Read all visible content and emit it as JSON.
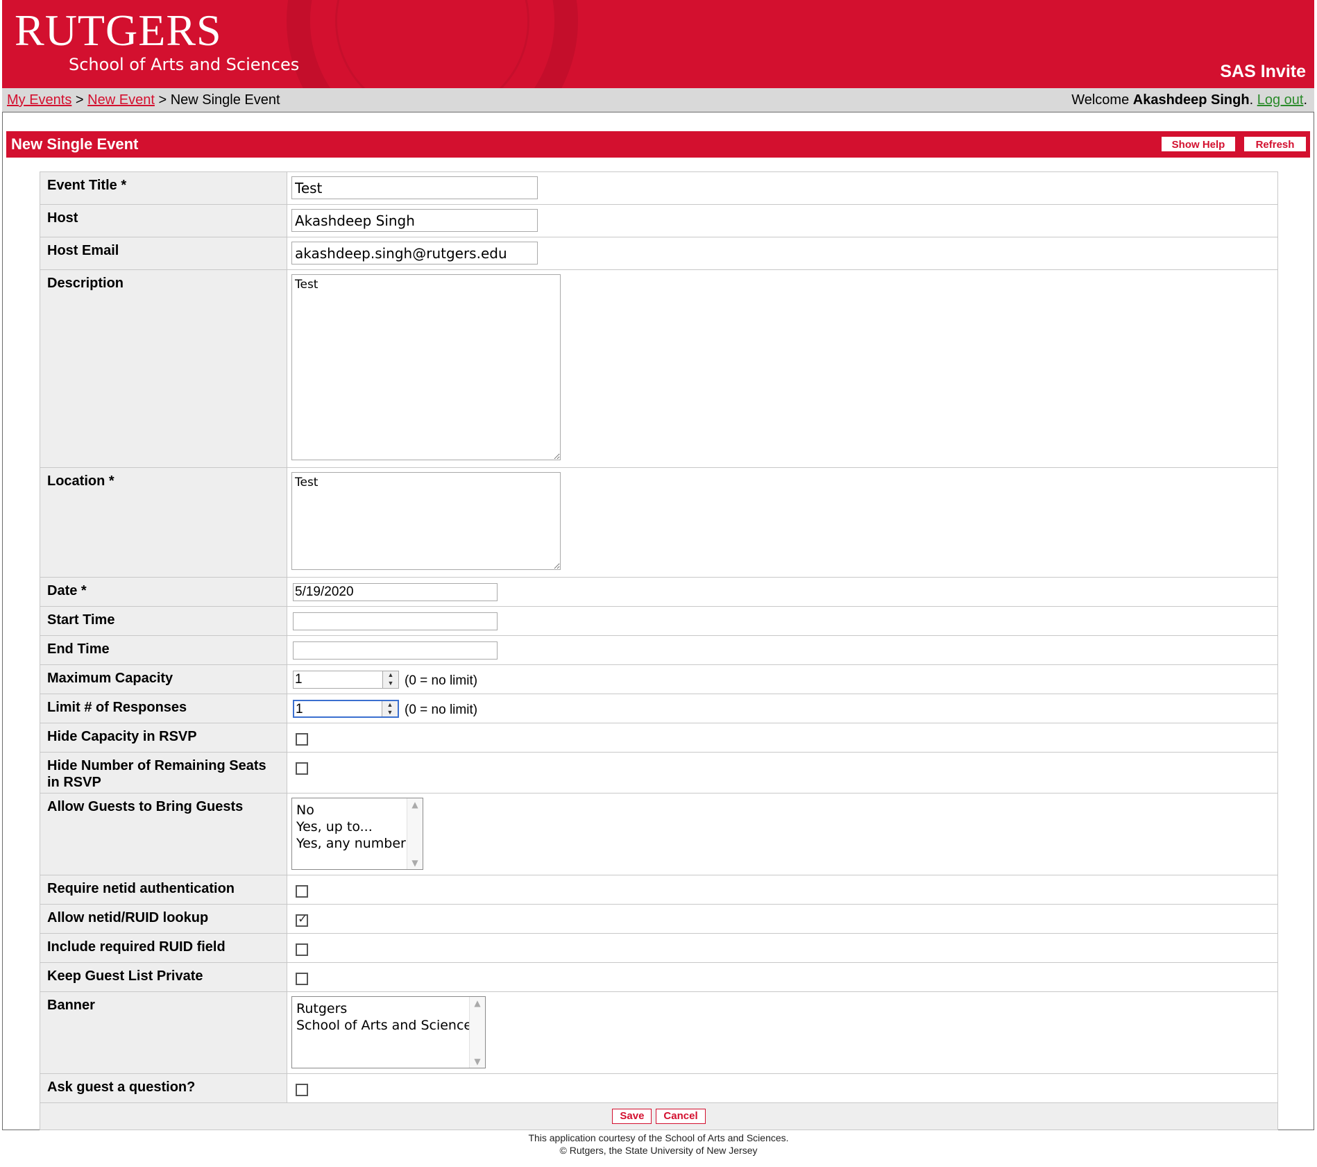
{
  "header": {
    "logo_main": "RUTGERS",
    "logo_sub": "School of Arts and Sciences",
    "app_title": "SAS Invite",
    "brand_color": "#d3102f"
  },
  "breadcrumb": {
    "items": [
      {
        "label": "My Events"
      },
      {
        "label": "New Event"
      },
      {
        "label": "New Single Event"
      }
    ],
    "separator": ">"
  },
  "user": {
    "welcome": "Welcome",
    "name": "Akashdeep Singh",
    "period": ".",
    "logout": "Log out"
  },
  "section": {
    "title": "New Single Event",
    "show_help": "Show Help",
    "refresh": "Refresh"
  },
  "form": {
    "event_title": {
      "label": "Event Title *",
      "value": "Test"
    },
    "host": {
      "label": "Host",
      "value": "Akashdeep Singh"
    },
    "host_email": {
      "label": "Host Email",
      "value": "akashdeep.singh@rutgers.edu"
    },
    "description": {
      "label": "Description",
      "value": "Test"
    },
    "location": {
      "label": "Location *",
      "value": "Test"
    },
    "date": {
      "label": "Date *",
      "value": "5/19/2020"
    },
    "start_time": {
      "label": "Start Time",
      "value": ""
    },
    "end_time": {
      "label": "End Time",
      "value": ""
    },
    "max_capacity": {
      "label": "Maximum Capacity",
      "value": "1",
      "hint": "(0 = no limit)"
    },
    "limit_responses": {
      "label": "Limit # of Responses",
      "value": "1",
      "hint": "(0 = no limit)"
    },
    "hide_capacity": {
      "label": "Hide Capacity in RSVP",
      "checked": false
    },
    "hide_remaining": {
      "label": "Hide Number of Remaining Seats in RSVP",
      "checked": false
    },
    "guests_bring_guests": {
      "label": "Allow Guests to Bring Guests",
      "options": [
        "No",
        "Yes, up to...",
        "Yes, any number"
      ]
    },
    "require_netid": {
      "label": "Require netid authentication",
      "checked": false
    },
    "allow_lookup": {
      "label": "Allow netid/RUID lookup",
      "checked": true
    },
    "include_ruid": {
      "label": "Include required RUID field",
      "checked": false
    },
    "keep_private": {
      "label": "Keep Guest List Private",
      "checked": false
    },
    "banner": {
      "label": "Banner",
      "options": [
        "Rutgers",
        "School of Arts and Sciences"
      ]
    },
    "ask_question": {
      "label": "Ask guest a question?",
      "checked": false
    },
    "save": "Save",
    "cancel": "Cancel"
  },
  "footer": {
    "line1": "This application courtesy of the School of Arts and Sciences.",
    "line2": "© Rutgers, the State University of New Jersey"
  }
}
